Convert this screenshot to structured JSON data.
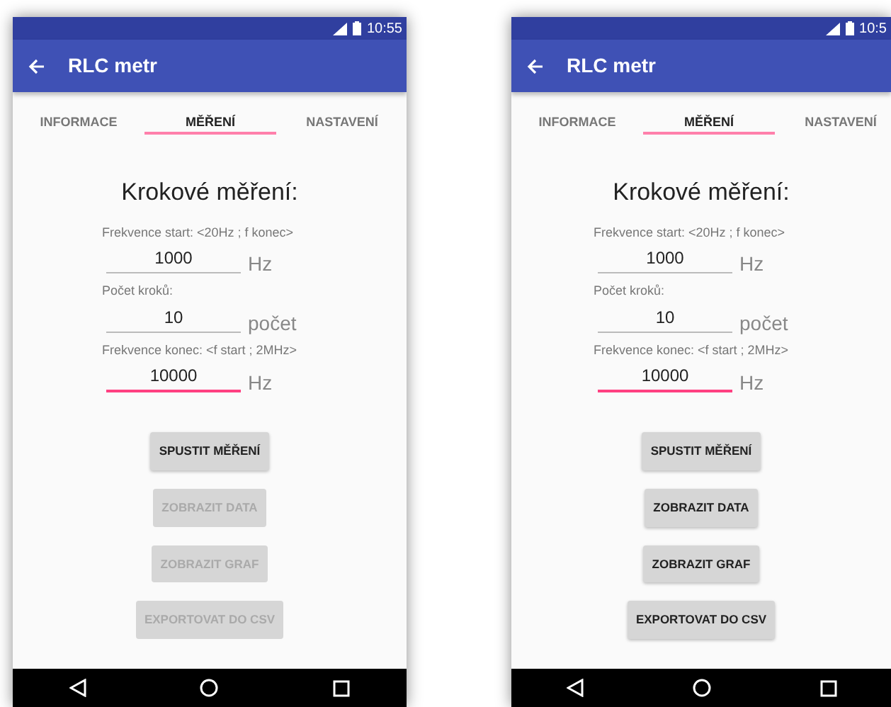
{
  "screens": [
    {
      "status_time": "10:55",
      "title": "RLC metr",
      "tabs": [
        {
          "label": "INFORMACE",
          "selected": false
        },
        {
          "label": "MĚŘENÍ",
          "selected": true
        },
        {
          "label": "NASTAVENÍ",
          "selected": false
        }
      ],
      "heading": "Krokové měření:",
      "fields": [
        {
          "label": "Frekvence start: <20Hz ; f konec>",
          "value": "1000",
          "unit": "Hz",
          "focused": false
        },
        {
          "label": "Počet kroků:",
          "value": "10",
          "unit": "počet",
          "focused": false
        },
        {
          "label": "Frekvence konec: <f start ; 2MHz>",
          "value": "10000",
          "unit": "Hz",
          "focused": true
        }
      ],
      "buttons": [
        {
          "label": "SPUSTIT MĚŘENÍ",
          "disabled": false
        },
        {
          "label": "ZOBRAZIT DATA",
          "disabled": true
        },
        {
          "label": "ZOBRAZIT GRAF",
          "disabled": true
        },
        {
          "label": "EXPORTOVAT DO CSV",
          "disabled": true
        }
      ]
    },
    {
      "status_time": "10:5",
      "title": "RLC metr",
      "tabs": [
        {
          "label": "INFORMACE",
          "selected": false
        },
        {
          "label": "MĚŘENÍ",
          "selected": true
        },
        {
          "label": "NASTAVENÍ",
          "selected": false
        }
      ],
      "heading": "Krokové měření:",
      "fields": [
        {
          "label": "Frekvence start: <20Hz ; f konec>",
          "value": "1000",
          "unit": "Hz",
          "focused": false
        },
        {
          "label": "Počet kroků:",
          "value": "10",
          "unit": "počet",
          "focused": false
        },
        {
          "label": "Frekvence konec: <f start ; 2MHz>",
          "value": "10000",
          "unit": "Hz",
          "focused": true
        }
      ],
      "buttons": [
        {
          "label": "SPUSTIT MĚŘENÍ",
          "disabled": false
        },
        {
          "label": "ZOBRAZIT DATA",
          "disabled": false
        },
        {
          "label": "ZOBRAZIT GRAF",
          "disabled": false
        },
        {
          "label": "EXPORTOVAT DO CSV",
          "disabled": false
        }
      ]
    }
  ]
}
